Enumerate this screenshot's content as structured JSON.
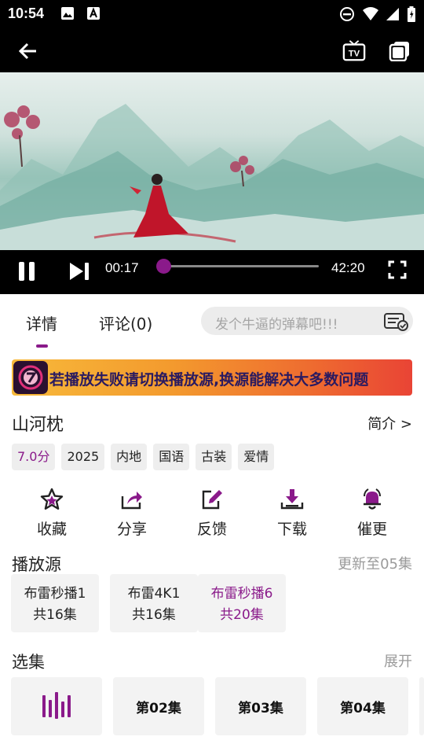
{
  "status_bar": {
    "time": "10:54"
  },
  "player": {
    "current_time": "00:17",
    "duration": "42:20",
    "progress": 0.0067
  },
  "tabs": [
    {
      "label": "详情"
    },
    {
      "label": "评论(0)"
    }
  ],
  "danmu": {
    "placeholder": "发个牛逼的弹幕吧!!!"
  },
  "banner": {
    "text": "若播放失败请切换播放源,换源能解决大多数问题"
  },
  "show": {
    "title": "山河枕",
    "intro_label": "简介 >",
    "tags": [
      "7.0分",
      "2025",
      "内地",
      "国语",
      "古装",
      "爱情"
    ]
  },
  "actions": [
    {
      "label": "收藏",
      "icon": "star-icon"
    },
    {
      "label": "分享",
      "icon": "share-icon"
    },
    {
      "label": "反馈",
      "icon": "edit-icon"
    },
    {
      "label": "下载",
      "icon": "download-icon"
    },
    {
      "label": "催更",
      "icon": "bell-icon"
    }
  ],
  "sources_section": {
    "title": "播放源",
    "update": "更新至05集",
    "items": [
      {
        "name": "布雷秒播1",
        "count": "共16集"
      },
      {
        "name": "布雷4K1",
        "count": "共16集"
      },
      {
        "name": "布雷秒播6",
        "count": "共20集"
      }
    ]
  },
  "episodes_section": {
    "title": "选集",
    "expand": "展开",
    "items": [
      "第02集",
      "第03集",
      "第04集"
    ]
  },
  "colors": {
    "accent": "#8a1a8a"
  }
}
